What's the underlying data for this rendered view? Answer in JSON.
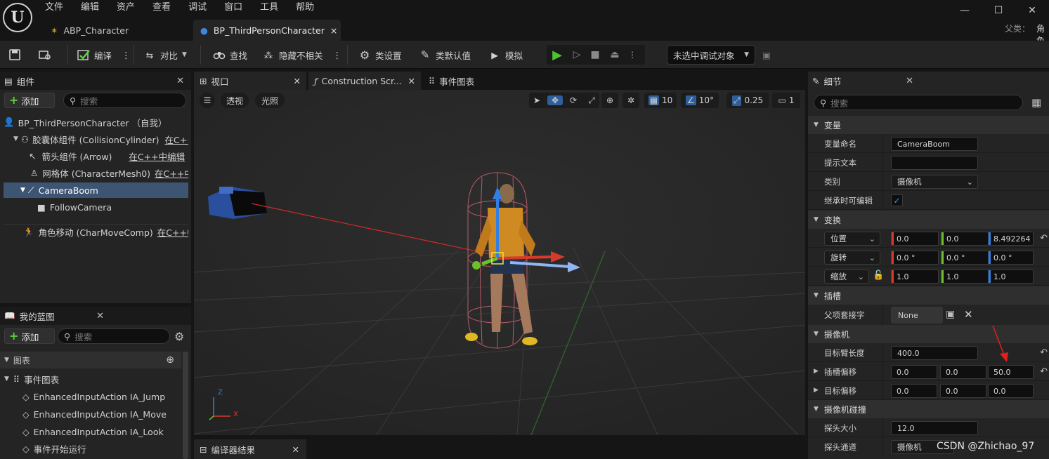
{
  "menu": [
    "文件",
    "编辑",
    "资产",
    "查看",
    "调试",
    "窗口",
    "工具",
    "帮助"
  ],
  "doc_tabs": [
    {
      "label": "ABP_Character"
    },
    {
      "label": "BP_ThirdPersonCharacter",
      "close": "×"
    }
  ],
  "parent_label": "父类：",
  "parent_value": "角色",
  "toolbar": {
    "compile": "编译",
    "diff": "对比",
    "find": "查找",
    "hide_unrelated": "隐藏不相关",
    "class_settings": "类设置",
    "class_defaults": "类默认值",
    "simulate": "模拟",
    "debug_target": "未选中调试对象"
  },
  "components": {
    "title": "组件",
    "add_label": "添加",
    "search_placeholder": "搜索",
    "items": [
      {
        "label": "BP_ThirdPersonCharacter （自我）"
      },
      {
        "label": "胶囊体组件 (CollisionCylinder)",
        "link": "在C++中编辑"
      },
      {
        "label": "箭头组件 (Arrow)",
        "link": "在C++中编辑"
      },
      {
        "label": "网格体 (CharacterMesh0)",
        "link": "在C++中编辑"
      },
      {
        "label": "CameraBoom"
      },
      {
        "label": "FollowCamera"
      },
      {
        "label": "角色移动 (CharMoveComp)",
        "link": "在C++中编辑"
      }
    ]
  },
  "my_blueprint": {
    "title": "我的蓝图",
    "add_label": "添加",
    "search_placeholder": "搜索",
    "graphs_label": "图表",
    "event_graph": "事件图表",
    "events": [
      "EnhancedInputAction IA_Jump",
      "EnhancedInputAction IA_Move",
      "EnhancedInputAction IA_Look",
      "事件开始运行"
    ]
  },
  "editor_tabs": [
    {
      "label": "视口"
    },
    {
      "label": "Construction Scr..."
    },
    {
      "label": "事件图表"
    }
  ],
  "viewport": {
    "perspective": "透视",
    "lit": "光照",
    "grid_snap": "10",
    "rot_snap": "10°",
    "scale_snap": "0.25",
    "camera_speed": "1",
    "axis_x": "X",
    "axis_z": "Z"
  },
  "compiler_results": "编译器结果",
  "details": {
    "title": "细节",
    "search_placeholder": "搜索",
    "sections": {
      "variable": "变量",
      "transform": "变换",
      "sockets": "插槽",
      "camera": "摄像机",
      "camera_collision": "摄像机碰撞"
    },
    "var_name_label": "变量命名",
    "var_name": "CameraBoom",
    "tooltip_label": "提示文本",
    "tooltip": "",
    "category_label": "类别",
    "category": "摄像机",
    "editable_label": "继承时可编辑",
    "editable_check": "✓",
    "location_label": "位置",
    "location": [
      "0.0",
      "0.0",
      "8.492264"
    ],
    "rotation_label": "旋转",
    "rotation": [
      "0.0 °",
      "0.0 °",
      "0.0 °"
    ],
    "scale_label": "缩放",
    "scale": [
      "1.0",
      "1.0",
      "1.0"
    ],
    "parent_socket_label": "父项套接字",
    "parent_socket": "None",
    "target_arm_label": "目标臂长度",
    "target_arm": "400.0",
    "socket_offset_label": "插槽偏移",
    "socket_offset": [
      "0.0",
      "0.0",
      "50.0"
    ],
    "target_offset_label": "目标偏移",
    "target_offset": [
      "0.0",
      "0.0",
      "0.0"
    ],
    "probe_size_label": "探头大小",
    "probe_size": "12.0",
    "probe_channel_label": "探头通道",
    "probe_channel": "摄像机"
  },
  "watermark": "CSDN @Zhichao_97",
  "colors": {
    "accent_selected": "#3d5573",
    "x_axis": "#d63a2a",
    "y_axis": "#6cbf2a",
    "z_axis": "#2f7fe6",
    "play_green": "#4fc32f"
  }
}
